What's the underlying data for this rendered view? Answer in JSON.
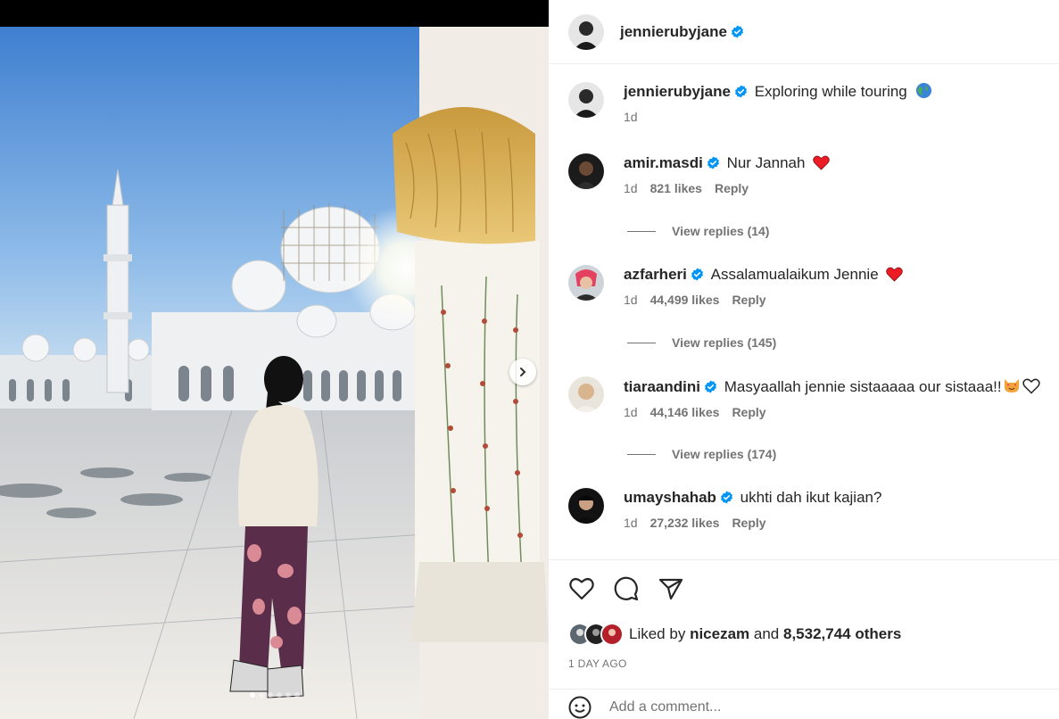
{
  "post": {
    "author": "jennierubyjane",
    "caption": "Exploring while touring",
    "caption_time": "1d"
  },
  "comments": [
    {
      "user": "amir.masdi",
      "text": "Nur Jannah",
      "emoji": "red-heart",
      "time": "1d",
      "likes": "821 likes",
      "reply": "Reply",
      "view_replies": "View replies (14)"
    },
    {
      "user": "azfarheri",
      "text": "Assalamualaikum Jennie",
      "emoji": "red-heart",
      "time": "1d",
      "likes": "44,499 likes",
      "reply": "Reply",
      "view_replies": "View replies (145)"
    },
    {
      "user": "tiaraandini",
      "text": "Masyaallah jennie sistaaaaa our sistaaa!!",
      "emoji": "heart-eyes-cat + white-heart",
      "time": "1d",
      "likes": "44,146 likes",
      "reply": "Reply",
      "view_replies": "View replies (174)"
    },
    {
      "user": "umayshahab",
      "text": "ukhti dah ikut kajian?",
      "emoji": "",
      "time": "1d",
      "likes": "27,232 likes",
      "reply": "Reply",
      "view_replies": ""
    }
  ],
  "likes": {
    "prefix": "Liked by",
    "user": "nicezam",
    "and": "and",
    "others": "8,532,744 others"
  },
  "timestamp": "1 DAY AGO",
  "add_comment": {
    "placeholder": "Add a comment..."
  },
  "colors": {
    "verified": "#0095f6",
    "heart": "#ed1c24",
    "muted": "#737373"
  },
  "icons": [
    "heart-icon",
    "comment-icon",
    "share-icon",
    "verified-icon",
    "globe-emoji",
    "chevron-right-icon",
    "smiley-icon"
  ]
}
